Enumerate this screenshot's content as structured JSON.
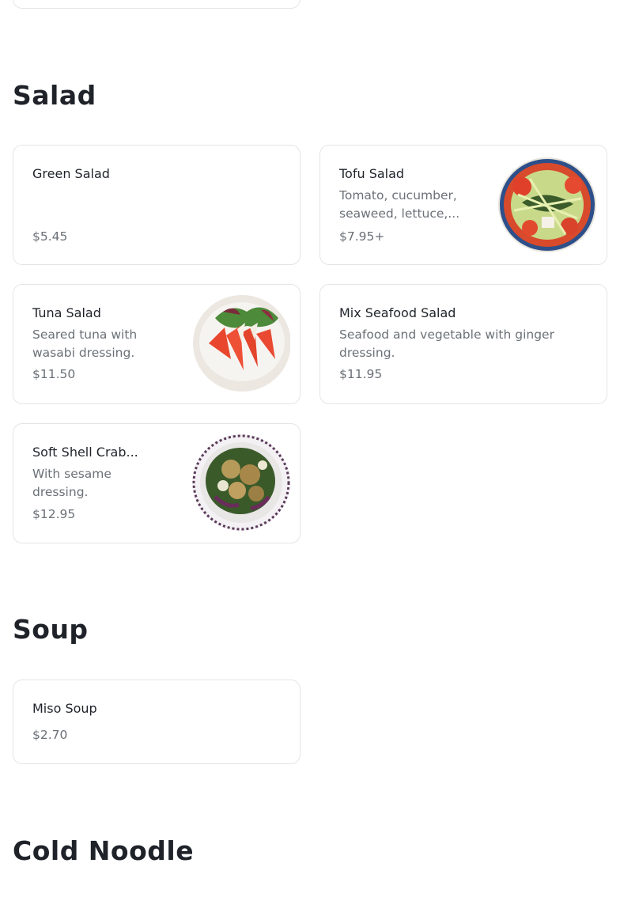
{
  "sections": [
    {
      "title": "Salad",
      "items": [
        {
          "name": "Green Salad",
          "description": "",
          "price": "$5.45",
          "image": "none"
        },
        {
          "name": "Tofu Salad",
          "description": "Tomato, cucumber, seaweed, lettuce,...",
          "price": "$7.95+",
          "image": "tofu-salad-photo"
        },
        {
          "name": "Tuna Salad",
          "description": "Seared tuna with wasabi dressing.",
          "price": "$11.50",
          "image": "tuna-salad-photo"
        },
        {
          "name": "Mix Seafood Salad",
          "description": "Seafood and vegetable with ginger dressing.",
          "price": "$11.95",
          "image": "none"
        },
        {
          "name": "Soft Shell Crab...",
          "description": "With sesame dressing.",
          "price": "$12.95",
          "image": "soft-shell-crab-salad-photo"
        }
      ]
    },
    {
      "title": "Soup",
      "items": [
        {
          "name": "Miso Soup",
          "description": "",
          "price": "$2.70",
          "image": "none"
        }
      ]
    },
    {
      "title": "Cold Noodle",
      "items": []
    }
  ],
  "colors": {
    "text_primary": "#1f2329",
    "text_secondary": "#6b7077",
    "card_border": "#e3e5e8"
  }
}
